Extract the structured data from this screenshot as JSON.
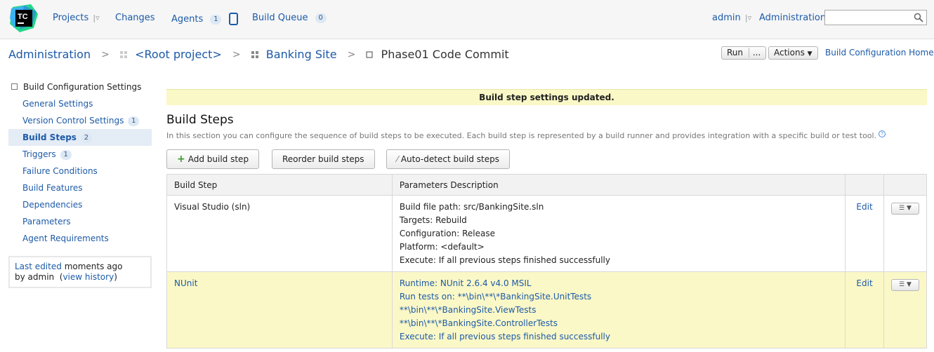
{
  "header": {
    "logo_text": "TC",
    "projects": "Projects",
    "changes": "Changes",
    "agents": "Agents",
    "agents_count": "1",
    "build_queue": "Build Queue",
    "build_queue_count": "0",
    "user": "admin",
    "administration": "Administration",
    "search_placeholder": ""
  },
  "breadcrumb": {
    "admin": "Administration",
    "root": "<Root project>",
    "project": "Banking Site",
    "current": "Phase01 Code Commit"
  },
  "toolbar": {
    "run": "Run",
    "run_more": "...",
    "actions": "Actions",
    "home": "Build Configuration Home"
  },
  "sidebar": {
    "title": "Build Configuration Settings",
    "items": [
      {
        "label": "General Settings",
        "count": ""
      },
      {
        "label": "Version Control Settings",
        "count": "1"
      },
      {
        "label": "Build Steps",
        "count": "2"
      },
      {
        "label": "Triggers",
        "count": "1"
      },
      {
        "label": "Failure Conditions",
        "count": ""
      },
      {
        "label": "Build Features",
        "count": ""
      },
      {
        "label": "Dependencies",
        "count": ""
      },
      {
        "label": "Parameters",
        "count": ""
      },
      {
        "label": "Agent Requirements",
        "count": ""
      }
    ],
    "last_edited_link": "Last edited",
    "last_edited_time": "moments ago",
    "last_edited_by": "by admin",
    "view_history": "view history"
  },
  "main": {
    "banner": "Build step settings updated.",
    "title": "Build Steps",
    "description": "In this section you can configure the sequence of build steps to be executed. Each build step is represented by a build runner and provides integration with a specific build or test tool.",
    "add_step": "Add build step",
    "reorder": "Reorder build steps",
    "autodetect": "Auto-detect build steps",
    "col_step": "Build Step",
    "col_params": "Parameters Description",
    "edit_label": "Edit",
    "steps": [
      {
        "name": "Visual Studio (sln)",
        "params": [
          "Build file path: src/BankingSite.sln",
          "Targets: Rebuild",
          "Configuration: Release",
          "Platform: <default>",
          "Execute: If all previous steps finished successfully"
        ]
      },
      {
        "name": "NUnit",
        "params": [
          "Runtime: NUnit 2.6.4 v4.0 MSIL",
          "Run tests on: **\\bin\\**\\*BankingSite.UnitTests",
          "**\\bin\\**\\*BankingSite.ViewTests",
          "**\\bin\\**\\*BankingSite.ControllerTests",
          "Execute: If all previous steps finished successfully"
        ]
      }
    ]
  }
}
